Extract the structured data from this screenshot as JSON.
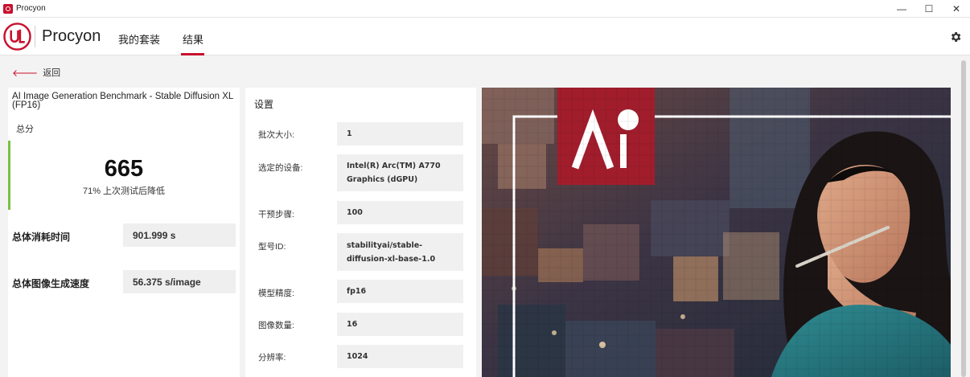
{
  "window": {
    "title": "Procyon",
    "controls": {
      "minimize": "—",
      "maximize": "☐",
      "close": "✕"
    }
  },
  "header": {
    "app_name": "Procyon",
    "tabs": [
      {
        "label": "我的套装",
        "active": false
      },
      {
        "label": "结果",
        "active": true
      }
    ],
    "accent_color": "#c8102e"
  },
  "back": {
    "label": "返回"
  },
  "result": {
    "benchmark_title": "AI Image Generation Benchmark - Stable Diffusion XL (FP16)",
    "score_label": "总分",
    "score": "665",
    "score_comparison": "71% 上次测试后降低",
    "metrics": [
      {
        "label": "总体消耗时间",
        "value": "901.999 s"
      },
      {
        "label": "总体图像生成速度",
        "value": "56.375 s/image"
      }
    ]
  },
  "settings": {
    "title": "设置",
    "items": [
      {
        "label": "批次大小:",
        "value": "1"
      },
      {
        "label": "选定的设备:",
        "value": "Intel(R) Arc(TM) A770 Graphics (dGPU)"
      },
      {
        "label": "干预步骤:",
        "value": "100"
      },
      {
        "label": "型号ID:",
        "value": "stabilityai/stable-diffusion-xl-base-1.0"
      },
      {
        "label": "模型精度:",
        "value": "fp16"
      },
      {
        "label": "图像数量:",
        "value": "16"
      },
      {
        "label": "分辨率:",
        "value": "1024"
      }
    ]
  },
  "banner": {
    "logo_text": "AI",
    "badge_color": "#a11d2c"
  }
}
